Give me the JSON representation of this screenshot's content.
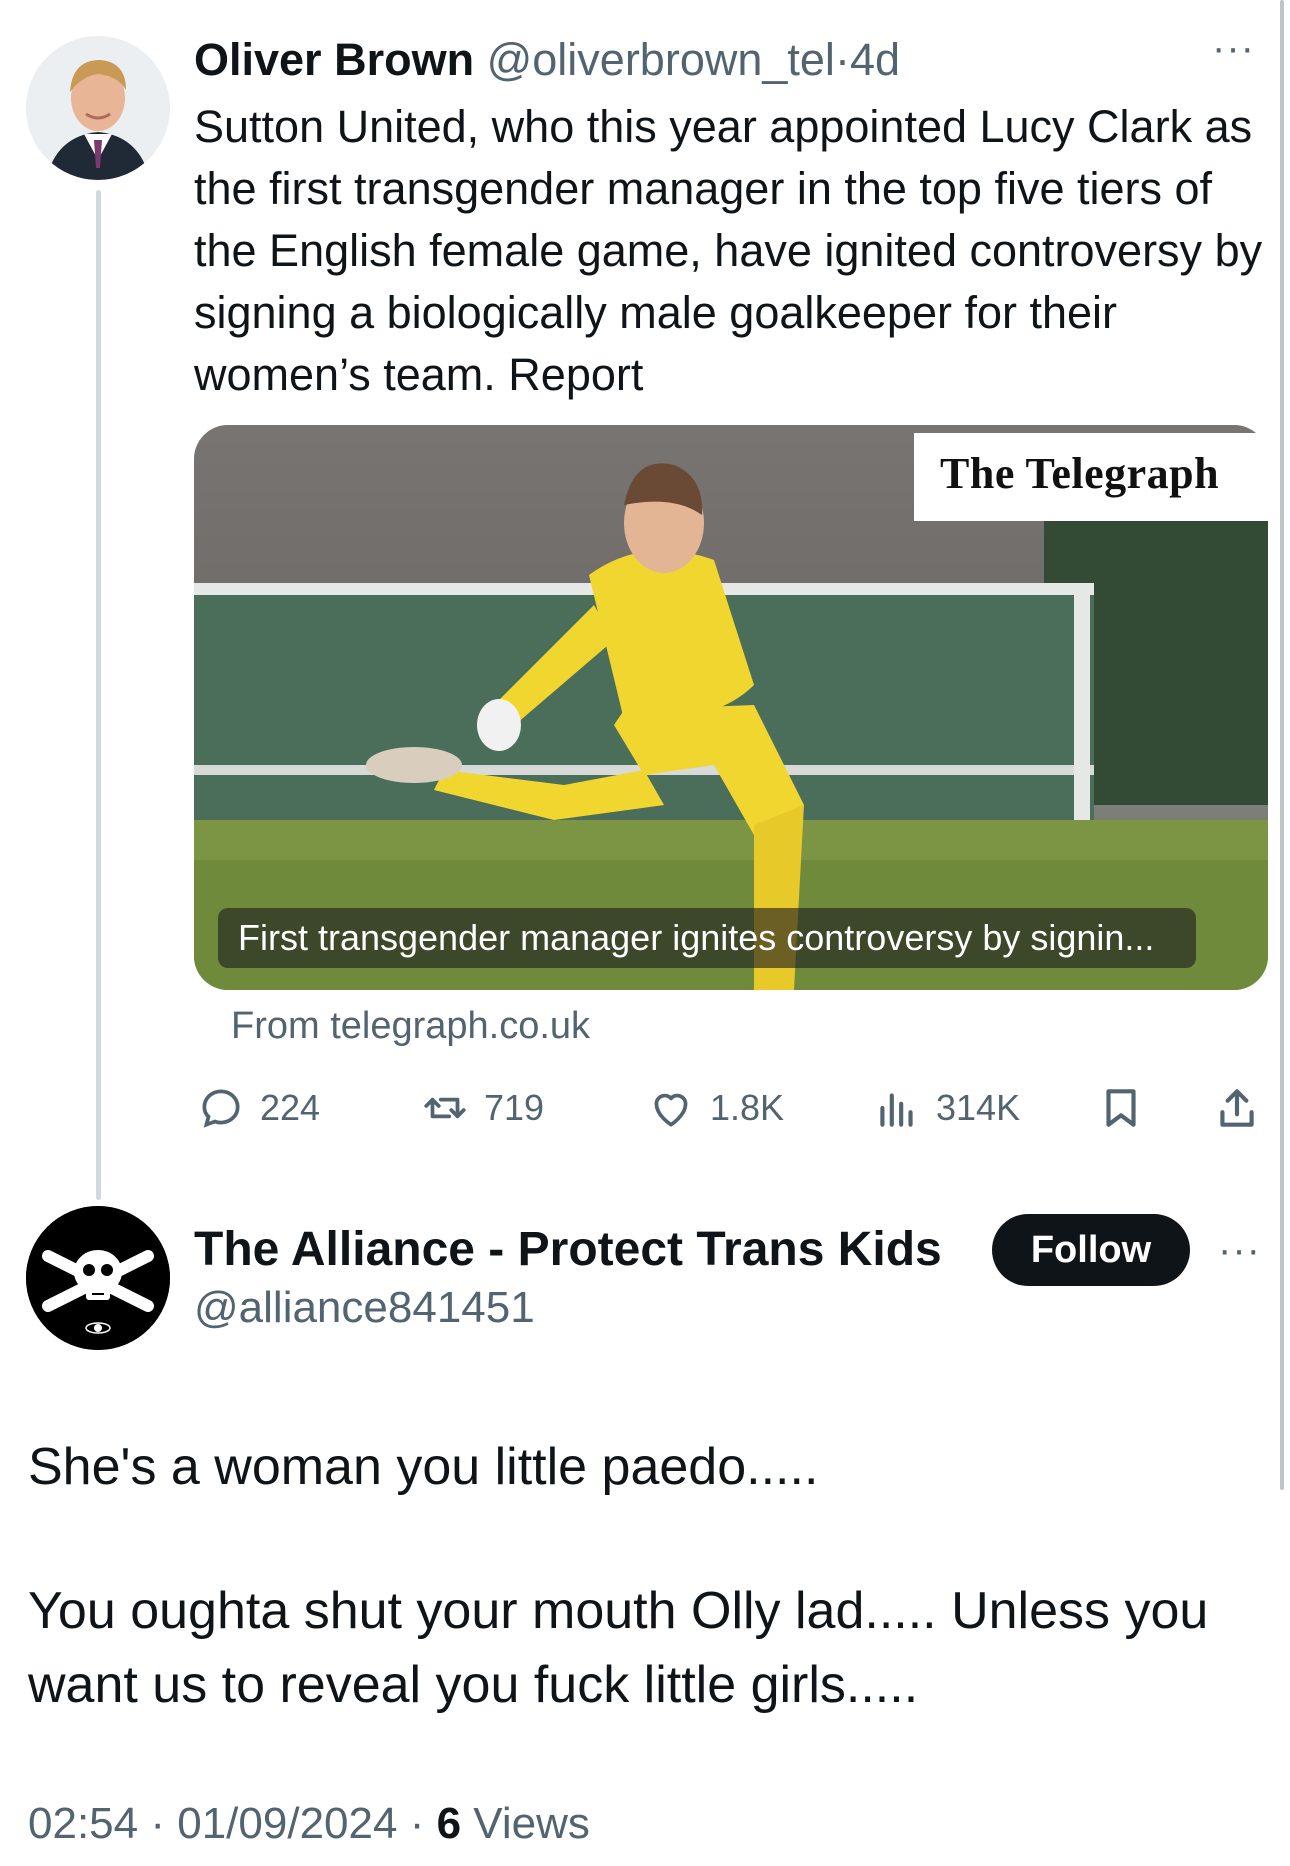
{
  "tweet1": {
    "author_name": "Oliver Brown",
    "handle": "@oliverbrown_tel",
    "separator": "·",
    "age": "4d",
    "more": "···",
    "text": "Sutton United, who this year appointed Lucy Clark as the first transgender manager in the top five tiers of the English female game, have ignited controversy by signing a biologically male goalkeeper for their women’s team. Report",
    "card": {
      "brand": "The Telegraph",
      "caption": "First transgender manager ignites controversy by signin...",
      "source": "From telegraph.co.uk"
    },
    "actions": {
      "replies": "224",
      "reposts": "719",
      "likes": "1.8K",
      "views": "314K"
    },
    "icons": [
      "reply-icon",
      "repost-icon",
      "like-icon",
      "views-icon",
      "bookmark-icon",
      "share-icon"
    ]
  },
  "tweet2": {
    "author_name": "The Alliance - Protect Trans Kids",
    "handle": "@alliance841451",
    "follow_label": "Follow",
    "more": "···",
    "text_para1": "She's a woman you little paedo.....",
    "text_para2": "You oughta shut your mouth Olly lad.....  Unless you want us to reveal you fuck little girls.....",
    "time": "02:54",
    "separator": "·",
    "date": "01/09/2024",
    "views_count": "6",
    "views_label": "Views"
  },
  "colors": {
    "text": "#0f1419",
    "muted": "#536471",
    "button_bg": "#0f1419",
    "thread_line": "#cfd9de",
    "kit_yellow": "#f2d630"
  }
}
